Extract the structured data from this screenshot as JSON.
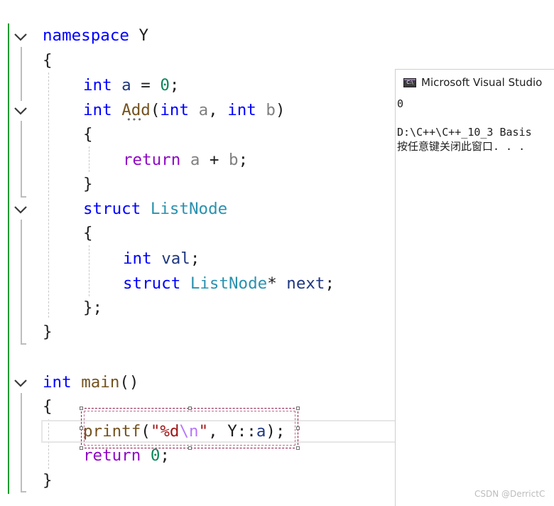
{
  "editor": {
    "code_lines": [
      {
        "id": "l1",
        "tokens": [
          [
            "kw",
            "namespace"
          ],
          [
            "",
            "&nbsp;Y"
          ]
        ]
      },
      {
        "id": "l2",
        "tokens": [
          [
            "",
            "{"
          ]
        ]
      },
      {
        "id": "l3",
        "tokens": [
          [
            "kw",
            "int"
          ],
          [
            "",
            ""
          ],
          [
            "var",
            "&nbsp;a"
          ],
          [
            "",
            " = "
          ],
          [
            "num",
            "0"
          ],
          [
            "",
            ";"
          ]
        ]
      },
      {
        "id": "l4",
        "tokens": [
          [
            "kw",
            "int"
          ],
          [
            "",
            " "
          ],
          [
            "fn",
            "Add"
          ],
          [
            "",
            "("
          ],
          [
            "kw",
            "int"
          ],
          [
            "",
            " "
          ],
          [
            "prm",
            "a"
          ],
          [
            "",
            ", "
          ],
          [
            "kw",
            "int"
          ],
          [
            "",
            " "
          ],
          [
            "prm",
            "b"
          ],
          [
            "",
            ")"
          ]
        ]
      },
      {
        "id": "l5",
        "tokens": [
          [
            "",
            "{"
          ]
        ]
      },
      {
        "id": "l6",
        "tokens": [
          [
            "kw2",
            "return"
          ],
          [
            "",
            " "
          ],
          [
            "prm",
            "a"
          ],
          [
            "",
            " + "
          ],
          [
            "prm",
            "b"
          ],
          [
            "",
            ";"
          ]
        ]
      },
      {
        "id": "l7",
        "tokens": [
          [
            "",
            "}"
          ]
        ]
      },
      {
        "id": "l8",
        "tokens": [
          [
            "kw",
            "struct"
          ],
          [
            "",
            " "
          ],
          [
            "ty",
            "ListNode"
          ]
        ]
      },
      {
        "id": "l9",
        "tokens": [
          [
            "",
            "{"
          ]
        ]
      },
      {
        "id": "l10",
        "tokens": [
          [
            "kw",
            "int"
          ],
          [
            "",
            " "
          ],
          [
            "var",
            "val"
          ],
          [
            "",
            ";"
          ]
        ]
      },
      {
        "id": "l11",
        "tokens": [
          [
            "kw",
            "struct"
          ],
          [
            "",
            " "
          ],
          [
            "ty",
            "ListNode"
          ],
          [
            "",
            "* "
          ],
          [
            "var",
            "next"
          ],
          [
            "",
            ";"
          ]
        ]
      },
      {
        "id": "l12",
        "tokens": [
          [
            "",
            "};"
          ]
        ]
      },
      {
        "id": "l13",
        "tokens": [
          [
            "",
            "}"
          ]
        ]
      },
      {
        "id": "l14",
        "tokens": [
          [
            "kw",
            "int"
          ],
          [
            "",
            " "
          ],
          [
            "fn",
            "main"
          ],
          [
            "",
            "()"
          ]
        ]
      },
      {
        "id": "l15",
        "tokens": [
          [
            "",
            "{"
          ]
        ]
      },
      {
        "id": "l16",
        "tokens": [
          [
            "fn",
            "printf"
          ],
          [
            "",
            "("
          ],
          [
            "str",
            "\"%d"
          ],
          [
            "esc",
            "\\n"
          ],
          [
            "str",
            "\""
          ],
          [
            "",
            ", Y::"
          ],
          [
            "var",
            "a"
          ],
          [
            "",
            ");"
          ]
        ]
      },
      {
        "id": "l17",
        "tokens": [
          [
            "kw2",
            "return"
          ],
          [
            "",
            " "
          ],
          [
            "num",
            "0"
          ],
          [
            "",
            ";"
          ]
        ]
      },
      {
        "id": "l18",
        "tokens": [
          [
            "",
            "}"
          ]
        ]
      }
    ]
  },
  "console": {
    "title": "Microsoft Visual Studio",
    "icon_text": "C:\\",
    "output_line_1": "0",
    "output_line_2": "",
    "output_line_3": "D:\\C++\\C++_10_3 Basis",
    "output_line_4": "按任意键关闭此窗口. . ."
  },
  "watermark": "CSDN @DerrictC",
  "colors": {
    "keyword": "#0000ff",
    "control_keyword": "#8f08c4",
    "type": "#2b91af",
    "function": "#74531f",
    "string": "#a31515",
    "escape": "#b776fb",
    "change_bar": "#1e9b2e",
    "selection": "#8b1a4a"
  }
}
